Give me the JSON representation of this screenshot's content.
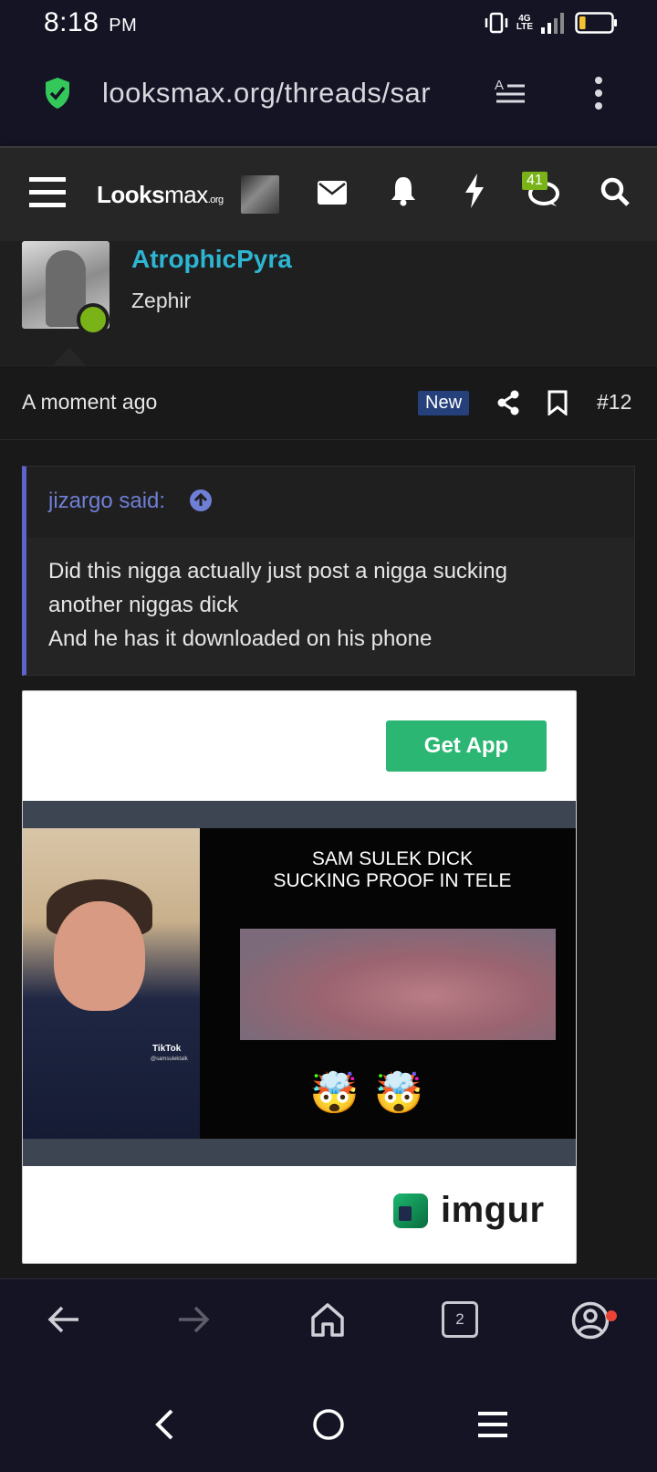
{
  "status_bar": {
    "time": "8:18",
    "ampm": "PM",
    "network_top": "4G",
    "network_bottom": "LTE",
    "battery_level": 0.2
  },
  "url_bar": {
    "url": "looksmax.org/threads/sar",
    "icons": [
      "shield-check-icon",
      "reader-mode-icon",
      "more-vert-icon"
    ]
  },
  "site_nav": {
    "logo_main": "Looks",
    "logo_thin": "max",
    "logo_org": ".org",
    "conversations_badge": "41",
    "icons": [
      "menu-icon",
      "mail-icon",
      "bell-icon",
      "bolt-icon",
      "chat-icon",
      "search-icon"
    ]
  },
  "post": {
    "username": "AtrophicPyra",
    "user_title": "Zephir",
    "time": "A moment ago",
    "new_label": "New",
    "post_number": "#12",
    "quote": {
      "author": "jizargo said:",
      "lines": [
        "Did this nigga actually just post a nigga sucking",
        "another niggas dick",
        "And he has it downloaded on his phone"
      ]
    },
    "embed": {
      "button": "Get App",
      "caption_line1": "SAM SULEK DICK",
      "caption_line2": "SUCKING PROOF IN TELE",
      "emojis": "🤯🤯",
      "tiktok_label": "TikTok",
      "tiktok_handle": "@samsulektalk",
      "brand": "imgur"
    }
  },
  "browser_toolbar": {
    "tab_count": "2",
    "icons": [
      "back-arrow-icon",
      "forward-arrow-icon",
      "home-icon",
      "tabs-icon",
      "account-icon"
    ]
  },
  "colors": {
    "accent_username": "#2db5d2",
    "quote_bar": "#5c63c9",
    "online": "#7ab317",
    "get_app": "#2cb673"
  }
}
